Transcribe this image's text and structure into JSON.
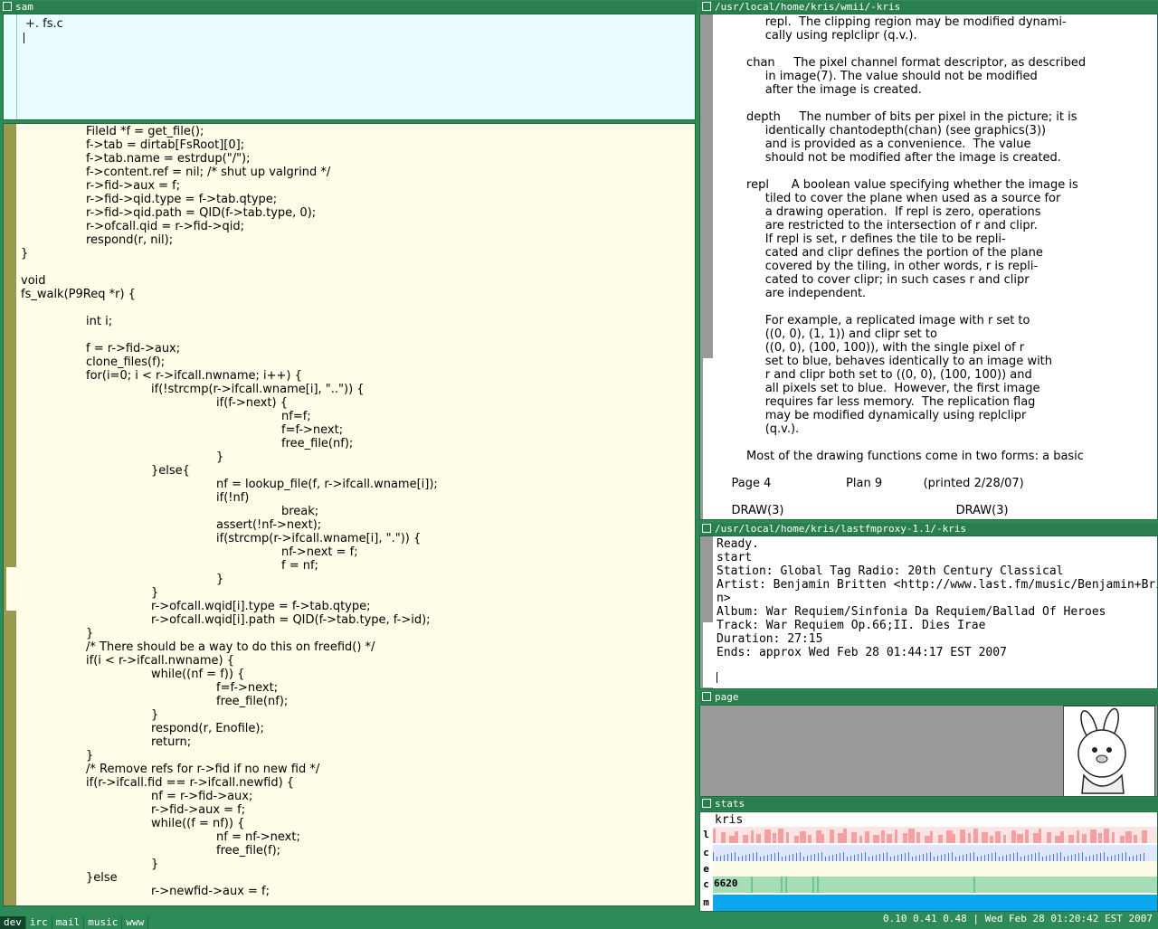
{
  "windows": {
    "sam_title": "sam",
    "man_title": "/usr/local/home/kris/wmii/-kris",
    "radio_title": "/usr/local/home/kris/lastfmproxy-1.1/-kris",
    "page_title": "page",
    "stats_title": "stats"
  },
  "sam": {
    "command": "+. fs.c",
    "code": [
      "\t\tFileId *f = get_file();",
      "\t\tf->tab = dirtab[FsRoot][0];",
      "\t\tf->tab.name = estrdup(\"/\");",
      "\t\tf->content.ref = nil; /* shut up valgrind */",
      "\t\tr->fid->aux = f;",
      "\t\tr->fid->qid.type = f->tab.qtype;",
      "\t\tr->fid->qid.path = QID(f->tab.type, 0);",
      "\t\tr->ofcall.qid = r->fid->qid;",
      "\t\trespond(r, nil);",
      "}",
      "",
      "void",
      "fs_walk(P9Req *r) {",
      "",
      "\t\tint i;",
      "",
      "\t\tf = r->fid->aux;",
      "\t\tclone_files(f);",
      "\t\tfor(i=0; i < r->ifcall.nwname; i++) {",
      "\t\t\t\tif(!strcmp(r->ifcall.wname[i], \"..\")) {",
      "\t\t\t\t\t\tif(f->next) {",
      "\t\t\t\t\t\t\t\tnf=f;",
      "\t\t\t\t\t\t\t\tf=f->next;",
      "\t\t\t\t\t\t\t\tfree_file(nf);",
      "\t\t\t\t\t\t}",
      "\t\t\t\t}else{",
      "\t\t\t\t\t\tnf = lookup_file(f, r->ifcall.wname[i]);",
      "\t\t\t\t\t\tif(!nf)",
      "\t\t\t\t\t\t\t\tbreak;",
      "\t\t\t\t\t\tassert(!nf->next);",
      "\t\t\t\t\t\tif(strcmp(r->ifcall.wname[i], \".\")) {",
      "\t\t\t\t\t\t\t\tnf->next = f;",
      "\t\t\t\t\t\t\t\tf = nf;",
      "\t\t\t\t\t\t}",
      "\t\t\t\t}",
      "\t\t\t\tr->ofcall.wqid[i].type = f->tab.qtype;",
      "\t\t\t\tr->ofcall.wqid[i].path = QID(f->tab.type, f->id);",
      "\t\t}",
      "\t\t/* There should be a way to do this on freefid() */",
      "\t\tif(i < r->ifcall.nwname) {",
      "\t\t\t\twhile((nf = f)) {",
      "\t\t\t\t\t\tf=f->next;",
      "\t\t\t\t\t\tfree_file(nf);",
      "\t\t\t\t}",
      "\t\t\t\trespond(r, Enofile);",
      "\t\t\t\treturn;",
      "\t\t}",
      "\t\t/* Remove refs for r->fid if no new fid */",
      "\t\tif(r->ifcall.fid == r->ifcall.newfid) {",
      "\t\t\t\tnf = r->fid->aux;",
      "\t\t\t\tr->fid->aux = f;",
      "\t\t\t\twhile((f = nf)) {",
      "\t\t\t\t\t\tnf = nf->next;",
      "\t\t\t\t\t\tfree_file(f);",
      "\t\t\t\t}",
      "\t\t}else",
      "\t\t\t\tr->newfid->aux = f;"
    ]
  },
  "man": {
    "lines": [
      "             repl.  The clipping region may be modified dynami-",
      "             cally using replclipr (q.v.).",
      "",
      "        chan     The pixel channel format descriptor, as described",
      "             in image(7). The value should not be modified",
      "             after the image is created.",
      "",
      "        depth     The number of bits per pixel in the picture; it is",
      "             identically chantodepth(chan) (see graphics(3))",
      "             and is provided as a convenience.  The value",
      "             should not be modified after the image is created.",
      "",
      "        repl      A boolean value specifying whether the image is",
      "             tiled to cover the plane when used as a source for",
      "             a drawing operation.  If repl is zero, operations",
      "             are restricted to the intersection of r and clipr.",
      "             If repl is set, r defines the tile to be repli-",
      "             cated and clipr defines the portion of the plane",
      "             covered by the tiling, in other words, r is repli-",
      "             cated to cover clipr; in such cases r and clipr",
      "             are independent.",
      "",
      "             For example, a replicated image with r set to",
      "             ((0, 0), (1, 1)) and clipr set to",
      "             ((0, 0), (100, 100)), with the single pixel of r",
      "             set to blue, behaves identically to an image with",
      "             r and clipr both set to ((0, 0), (100, 100)) and",
      "             all pixels set to blue.  However, the first image",
      "             requires far less memory.  The replication flag",
      "             may be modified dynamically using replclipr",
      "             (q.v.).",
      "",
      "        Most of the drawing functions come in two forms: a basic",
      "",
      "    Page 4                    Plan 9           (printed 2/28/07)",
      "",
      "    DRAW(3)                                              DRAW(3)"
    ]
  },
  "radio": {
    "lines": [
      "Ready.",
      "start",
      "Station: Global Tag Radio: 20th Century Classical",
      "Artist: Benjamin Britten <http://www.last.fm/music/Benjamin+Britte",
      "n>",
      "Album: War Requiem/Sinfonia Da Requiem/Ballad Of Heroes",
      "Track: War Requiem Op.66;II. Dies Irae",
      "Duration: 27:15",
      "Ends: approx Wed Feb 28 01:44:17 EST 2007"
    ]
  },
  "stats": {
    "host": "kris",
    "rows": [
      {
        "label": "l",
        "color": "#f4a0a0",
        "bg": "#fde4e4"
      },
      {
        "label": "c",
        "color": "#4a78d8",
        "bg": "#dfe8fb"
      },
      {
        "label": "e",
        "color": "#f0f0a0",
        "bg": "#fbfbe6"
      },
      {
        "label": "c",
        "value": "6620",
        "color": "#6ec48e",
        "bg": "#a6dcb6"
      },
      {
        "label": "m",
        "color": "#0aa6ee",
        "bg": "#0aa6ee"
      }
    ]
  },
  "tags": [
    "dev",
    "irc",
    "mail",
    "music",
    "www"
  ],
  "active_tag": "dev",
  "status": "0.10 0.41 0.48 | Wed Feb 28 01:20:42 EST 2007"
}
